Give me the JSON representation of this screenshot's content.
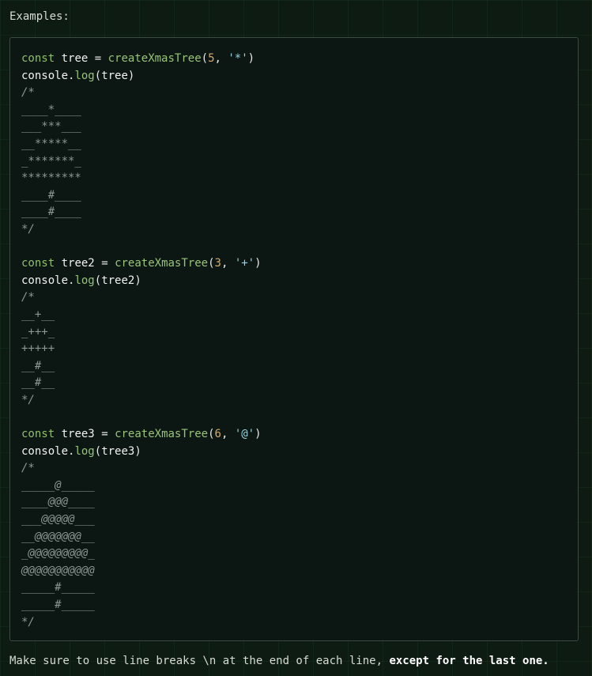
{
  "heading": "Examples:",
  "code": {
    "ex1": {
      "kw": "const",
      "var": "tree",
      "eq": "=",
      "fn": "createXmasTree",
      "arg_num": "5",
      "arg_str": "'*'",
      "log_obj": "console",
      "log_fn": "log",
      "log_arg": "tree",
      "comment_open": "/*",
      "lines": [
        "____*____",
        "___***___",
        "__*****__",
        "_*******_",
        "*********",
        "____#____",
        "____#____"
      ],
      "comment_close": "*/"
    },
    "ex2": {
      "kw": "const",
      "var": "tree2",
      "eq": "=",
      "fn": "createXmasTree",
      "arg_num": "3",
      "arg_str": "'+'",
      "log_obj": "console",
      "log_fn": "log",
      "log_arg": "tree2",
      "comment_open": "/*",
      "lines": [
        "__+__",
        "_+++_",
        "+++++",
        "__#__",
        "__#__"
      ],
      "comment_close": "*/"
    },
    "ex3": {
      "kw": "const",
      "var": "tree3",
      "eq": "=",
      "fn": "createXmasTree",
      "arg_num": "6",
      "arg_str": "'@'",
      "log_obj": "console",
      "log_fn": "log",
      "log_arg": "tree3",
      "comment_open": "/*",
      "lines": [
        "_____@_____",
        "____@@@____",
        "___@@@@@___",
        "__@@@@@@@__",
        "_@@@@@@@@@_",
        "@@@@@@@@@@@",
        "_____#_____",
        "_____#_____"
      ],
      "comment_close": "*/"
    }
  },
  "footer": {
    "text": "Make sure to use line breaks \\n at the end of each line, ",
    "bold": "except for the last one."
  }
}
